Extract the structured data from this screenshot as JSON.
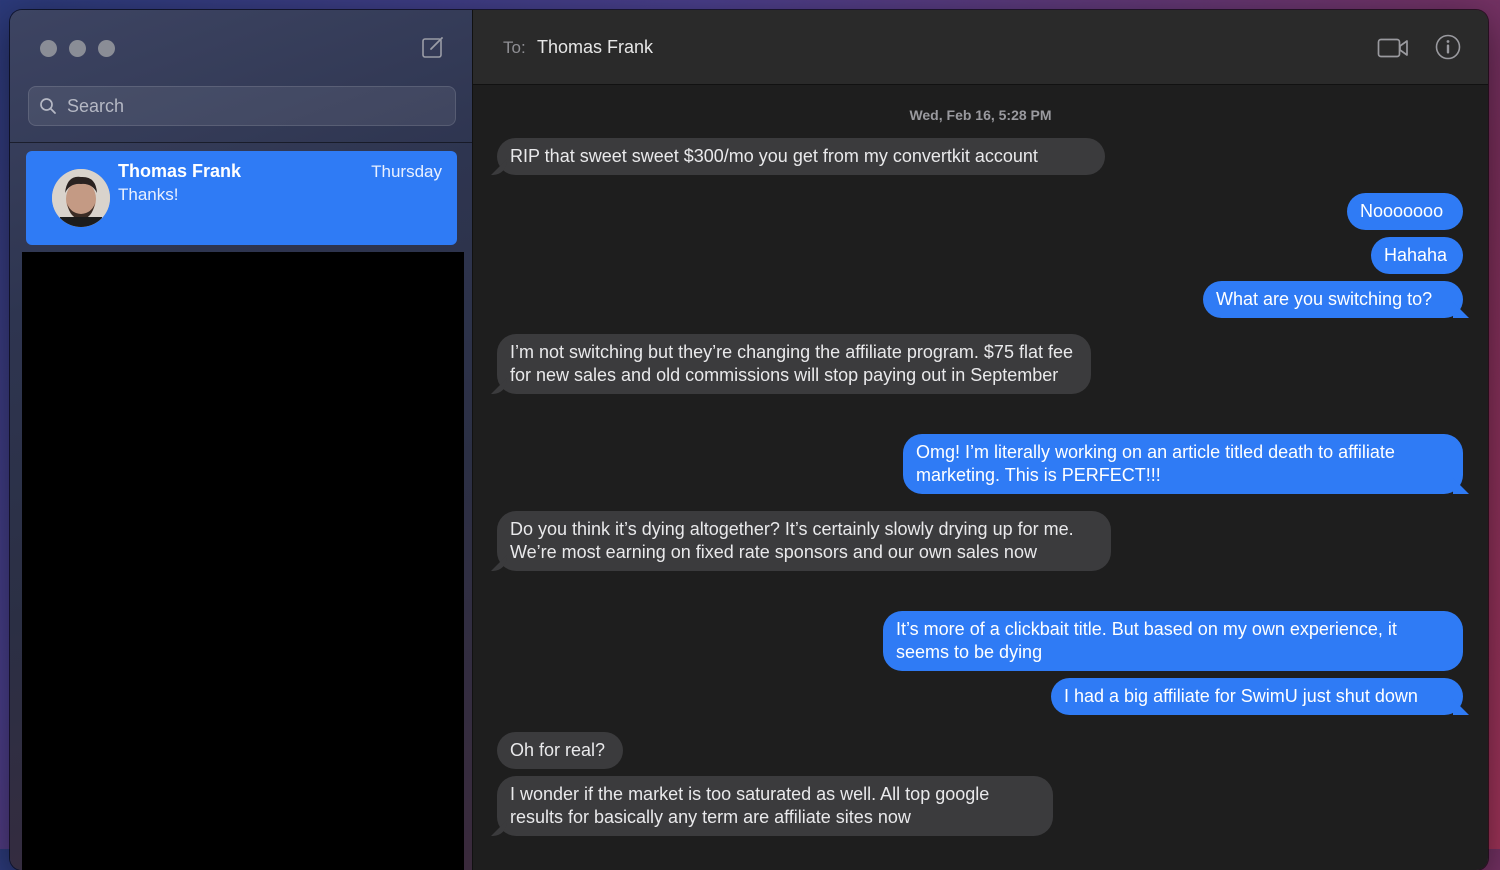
{
  "window": {
    "sidebar": {
      "search": {
        "placeholder": "Search"
      },
      "conversations": [
        {
          "name": "Thomas Frank",
          "date": "Thursday",
          "preview": "Thanks!"
        }
      ]
    },
    "header": {
      "to_label": "To:",
      "recipient": "Thomas Frank"
    }
  },
  "thread": {
    "timestamp": "Wed, Feb 16, 5:28 PM",
    "messages": [
      {
        "from": "them",
        "text": "RIP that sweet sweet $300/mo you get from my convertkit account"
      },
      {
        "from": "me",
        "text": "Nooooooo"
      },
      {
        "from": "me",
        "text": "Hahaha"
      },
      {
        "from": "me",
        "text": "What are you switching to?"
      },
      {
        "from": "them",
        "text": "I’m not switching but they’re changing the affiliate program. $75 flat fee for new sales and old commissions will stop paying out in September"
      },
      {
        "from": "me",
        "text": "Omg! I’m literally working on an article titled death to affiliate marketing. This is PERFECT!!!"
      },
      {
        "from": "them",
        "text": "Do you think it’s dying altogether? It’s certainly slowly drying up for me. We’re most earning on fixed rate sponsors and our own sales now"
      },
      {
        "from": "me",
        "text": "It’s more of a clickbait title. But based on my own experience, it seems to be dying"
      },
      {
        "from": "me",
        "text": "I had a big affiliate for SwimU just shut down"
      },
      {
        "from": "them",
        "text": "Oh for real?"
      },
      {
        "from": "them",
        "text": "I wonder if the market is too saturated as well. All top google results for basically any term are affiliate sites now"
      }
    ]
  },
  "colors": {
    "accent": "#2f7bf5",
    "incoming_bubble": "#3b3b3d",
    "background": "#1e1e1e"
  }
}
